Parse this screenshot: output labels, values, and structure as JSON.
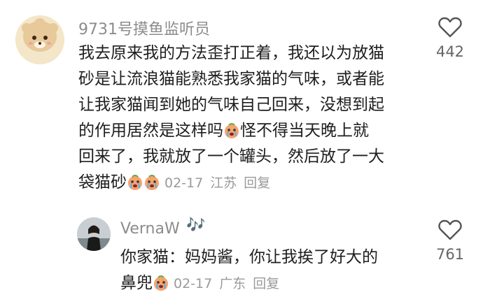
{
  "comment": {
    "username": "9731号摸鱼监听员",
    "lines": [
      "我去原来我的方法歪打正着，我还以为放猫",
      "砂是让流浪猫能熟悉我家猫的气味，或者能",
      "让我家猫闻到她的气味自己回来，没想到起",
      "的作用居然是这样吗",
      "怪不得当天晚上就",
      "回来了，我就放了一个罐头，然后放了一大",
      "袋猫砂"
    ],
    "date": "02-17",
    "location": "江苏",
    "reply_label": "回复",
    "likes": "442",
    "emoji": "crying-face-emoji"
  },
  "reply": {
    "username": "VernaW",
    "username_decoration": "🎶",
    "lines": [
      "你家猫：妈妈酱，你让我挨了好大的",
      "鼻兜"
    ],
    "date": "02-17",
    "location": "广东",
    "reply_label": "回复",
    "likes": "761",
    "emoji": "crying-face-emoji"
  },
  "colors": {
    "meta": "#9a9a9a",
    "username": "#8c8c8c",
    "text": "#1e1e1e",
    "emoji_face": "#f6a36d"
  }
}
